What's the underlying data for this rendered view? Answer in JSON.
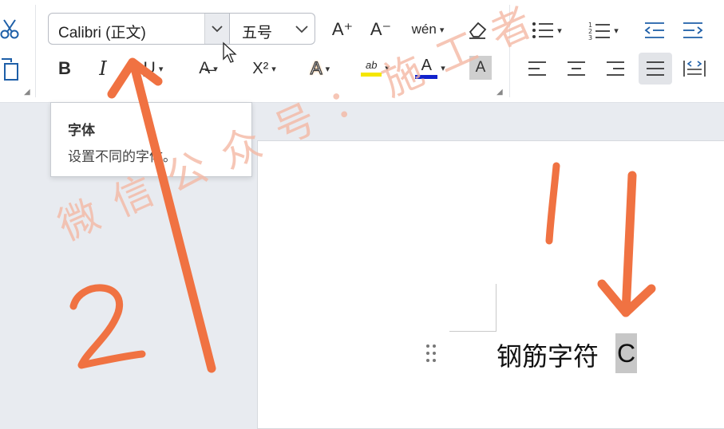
{
  "ribbon": {
    "font_name": "Calibri (正文)",
    "font_size": "五号",
    "buttons": {
      "bold": "B",
      "italic": "I",
      "underline": "U",
      "strikethrough": "A̶",
      "superscript": "X²",
      "text_effect": "A",
      "highlight": "ab",
      "font_color": "A",
      "char_shading": "A",
      "grow_font": "A⁺",
      "shrink_font": "A⁻",
      "phonetic": "wén",
      "clear_format": "⌫"
    },
    "colors": {
      "highlight": "#f5e600",
      "font_color": "#1122cc",
      "accent": "#2b579a"
    }
  },
  "tooltip": {
    "title": "字体",
    "description": "设置不同的字体。"
  },
  "document": {
    "text": "钢筋字符",
    "selected_char": "C"
  },
  "watermark": "微信公众号：施工者",
  "annotations": {
    "label_2": "2",
    "label_1": "1"
  }
}
